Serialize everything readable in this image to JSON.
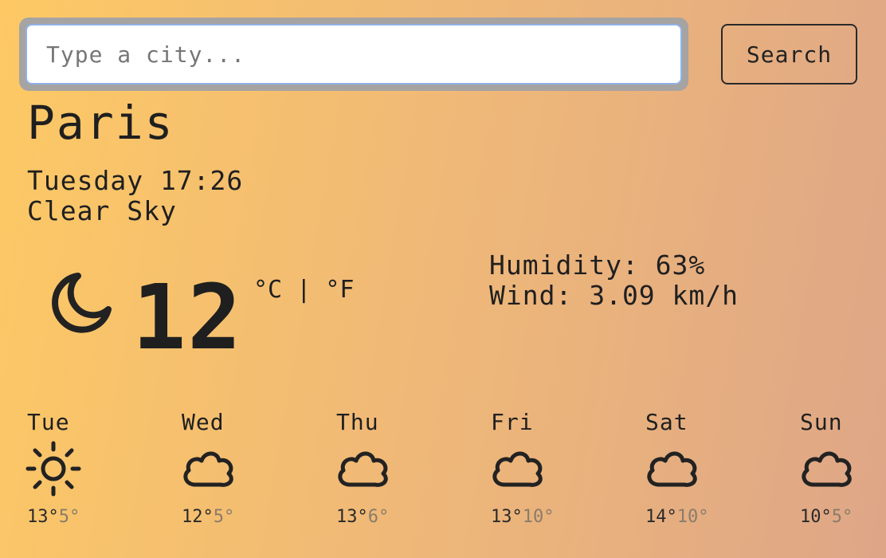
{
  "search": {
    "placeholder": "Type a city...",
    "value": "",
    "button_label": "Search"
  },
  "city": "Paris",
  "datetime": "Tuesday 17:26",
  "description": "Clear Sky",
  "current": {
    "icon": "moon-icon",
    "temperature": "12",
    "unit_celsius": "°C",
    "unit_separator": "|",
    "unit_fahrenheit": "°F"
  },
  "conditions": {
    "humidity": "Humidity: 63%",
    "wind": "Wind: 3.09 km/h"
  },
  "forecast": [
    {
      "day": "Tue",
      "icon": "sun-icon",
      "max": "13°",
      "min": "5°"
    },
    {
      "day": "Wed",
      "icon": "cloud-icon",
      "max": "12°",
      "min": "5°"
    },
    {
      "day": "Thu",
      "icon": "cloud-icon",
      "max": "13°",
      "min": "6°"
    },
    {
      "day": "Fri",
      "icon": "cloud-icon",
      "max": "13°",
      "min": "10°"
    },
    {
      "day": "Sat",
      "icon": "cloud-icon",
      "max": "14°",
      "min": "10°"
    },
    {
      "day": "Sun",
      "icon": "cloud-icon",
      "max": "10°",
      "min": "5°"
    }
  ],
  "colors": {
    "gradient_start": "#fdc964",
    "gradient_end": "#dea687",
    "text": "#1f1f1f",
    "min_temp": "#8a7c6a"
  }
}
